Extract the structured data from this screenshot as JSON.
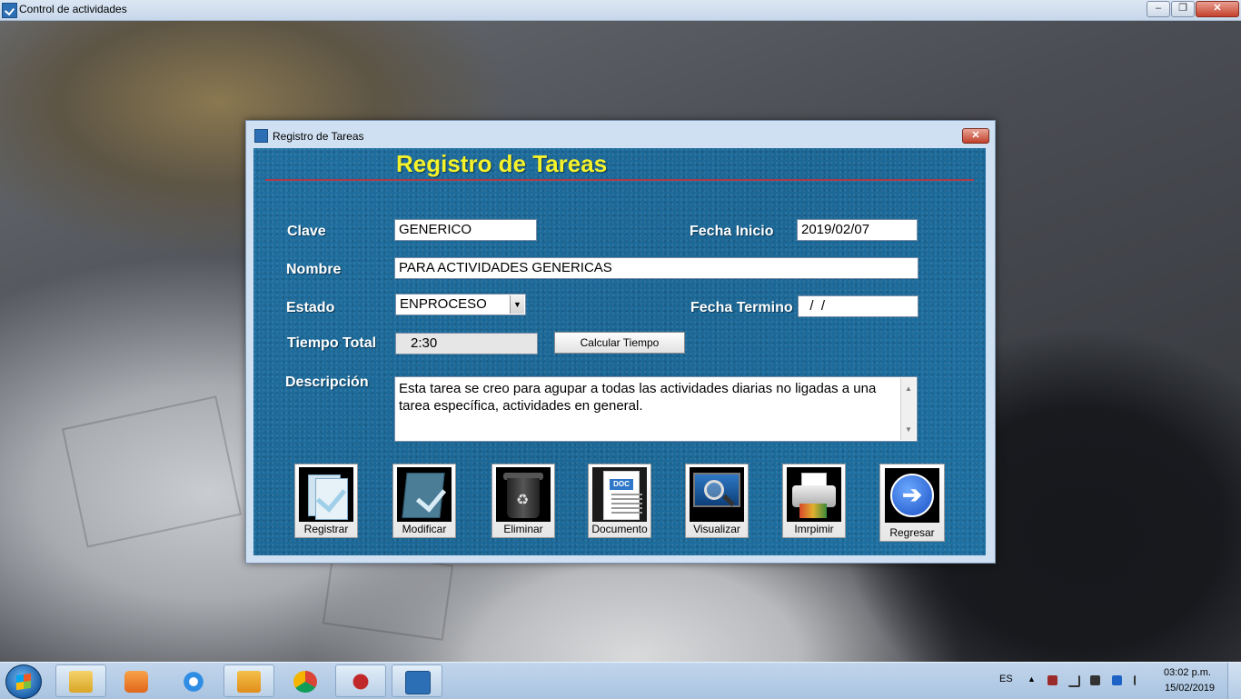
{
  "app": {
    "title": "Control de actividades",
    "controls": {
      "minimize": "–",
      "maximize": "❐",
      "close": "✕"
    }
  },
  "dialog": {
    "title": "Registro de Tareas",
    "close": "✕",
    "heading": "Registro de Tareas",
    "colors": {
      "heading": "#f6f22a",
      "rule": "#b23a48",
      "panel": "#1f6fa0"
    }
  },
  "form": {
    "clave": {
      "label": "Clave",
      "value": "GENERICO"
    },
    "fecha_inicio": {
      "label": "Fecha Inicio",
      "value": "2019/02/07"
    },
    "nombre": {
      "label": "Nombre",
      "value": "PARA ACTIVIDADES GENERICAS"
    },
    "estado": {
      "label": "Estado",
      "value": "ENPROCESO",
      "arrow": "▼"
    },
    "fecha_termino": {
      "label": "Fecha Termino",
      "value": "  /  /"
    },
    "tiempo_total": {
      "label": "Tiempo Total",
      "value": "2:30"
    },
    "calcular_label": "Calcular Tiempo",
    "descripcion": {
      "label": "Descripción",
      "value": "Esta tarea se creo para agupar a todas las actividades diarias no ligadas a una tarea específica, actividades en general."
    }
  },
  "actions": [
    {
      "label": "Registrar",
      "icon": "register-icon"
    },
    {
      "label": "Modificar",
      "icon": "modify-icon"
    },
    {
      "label": "Eliminar",
      "icon": "trash-icon"
    },
    {
      "label": "Documento",
      "icon": "document-icon"
    },
    {
      "label": "Visualizar",
      "icon": "magnifier-icon"
    },
    {
      "label": "Imrpimir",
      "icon": "printer-icon"
    },
    {
      "label": "Regresar",
      "icon": "arrow-right-icon"
    }
  ],
  "taskbar": {
    "apps": [
      "file-explorer-icon",
      "media-player-icon",
      "internet-explorer-icon",
      "outlook-icon",
      "chrome-icon",
      "splat-icon",
      "task-app-icon"
    ],
    "language": "ES",
    "time": "03:02 p.m.",
    "date": "15/02/2019"
  }
}
